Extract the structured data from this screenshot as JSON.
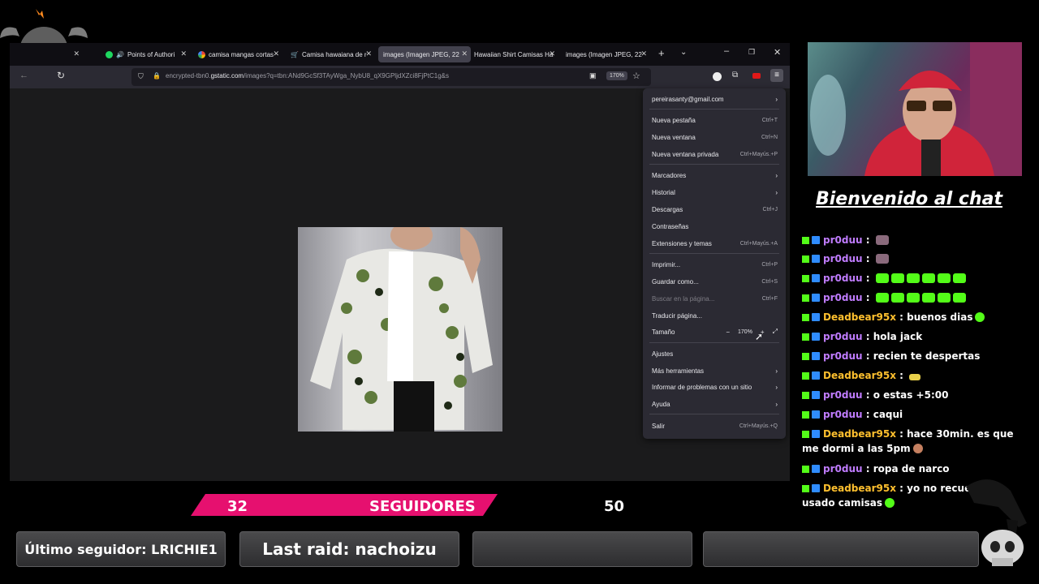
{
  "browser": {
    "tabs": [
      {
        "label": "Points of Authori",
        "icon": "spotify-icon"
      },
      {
        "label": "camisa mangas cortas",
        "icon": "google-icon"
      },
      {
        "label": "Camisa hawaiana de r",
        "icon": "cart-icon"
      },
      {
        "label": "images (Imagen JPEG, 22",
        "icon": "",
        "active": true
      },
      {
        "label": "Hawaiian Shirt Camisas Ha",
        "icon": ""
      },
      {
        "label": "images (Imagen JPEG, 22",
        "icon": ""
      }
    ],
    "url_prefix": "encrypted-tbn0.",
    "url_domain": "gstatic.com",
    "url_rest": "/images?q=tbn:ANd9GcSf3TAyWga_NybU8_qX9GPljdXZci8FjPtC1g&s",
    "zoom_badge": "170%",
    "menu": {
      "account": "pereirasanty@gmail.com",
      "items": [
        {
          "label": "Nueva pestaña",
          "shortcut": "Ctrl+T"
        },
        {
          "label": "Nueva ventana",
          "shortcut": "Ctrl+N"
        },
        {
          "label": "Nueva ventana privada",
          "shortcut": "Ctrl+Mayús.+P"
        },
        {
          "label": "Marcadores",
          "shortcut": ""
        },
        {
          "label": "Historial",
          "shortcut": ""
        },
        {
          "label": "Descargas",
          "shortcut": "Ctrl+J"
        },
        {
          "label": "Contraseñas",
          "shortcut": ""
        },
        {
          "label": "Extensiones y temas",
          "shortcut": "Ctrl+Mayús.+A"
        },
        {
          "label": "Imprimir...",
          "shortcut": "Ctrl+P"
        },
        {
          "label": "Guardar como...",
          "shortcut": "Ctrl+S"
        },
        {
          "label": "Buscar en la página...",
          "shortcut": "Ctrl+F"
        },
        {
          "label": "Traducir página...",
          "shortcut": ""
        },
        {
          "label": "Tamaño",
          "shortcut": ""
        },
        {
          "label": "Ajustes",
          "shortcut": ""
        },
        {
          "label": "Más herramientas",
          "shortcut": ""
        },
        {
          "label": "Informar de problemas con un sitio",
          "shortcut": ""
        },
        {
          "label": "Ayuda",
          "shortcut": ""
        },
        {
          "label": "Salir",
          "shortcut": "Ctrl+Mayús.+Q"
        }
      ],
      "zoom_value": "170%",
      "zoom_minus": "−",
      "zoom_plus": "+"
    }
  },
  "stream": {
    "welcome": "Bienvenido al chat",
    "chat": [
      {
        "user": "pr0duu",
        "msg": ""
      },
      {
        "user": "pr0duu",
        "msg": ""
      },
      {
        "user": "pr0duu",
        "msg": ""
      },
      {
        "user": "pr0duu",
        "msg": ""
      },
      {
        "user": "Deadbear95x",
        "msg": "buenos dias"
      },
      {
        "user": "pr0duu",
        "msg": "hola jack"
      },
      {
        "user": "pr0duu",
        "msg": "recien te despertas"
      },
      {
        "user": "Deadbear95x",
        "msg": ""
      },
      {
        "user": "pr0duu",
        "msg": "o estas +5:00"
      },
      {
        "user": "pr0duu",
        "msg": "caqui"
      },
      {
        "user": "Deadbear95x",
        "msg": "hace 30min. es que me dormi a las 5pm"
      },
      {
        "user": "pr0duu",
        "msg": "ropa de narco"
      },
      {
        "user": "Deadbear95x",
        "msg": "yo no recuerdo h usado camisas"
      }
    ],
    "sep": " : ",
    "followers_current": "32",
    "followers_label": "SEGUIDORES",
    "followers_goal": "50",
    "last_follower": "Último seguidor: LRICHIE1",
    "last_raid": "Last raid: nachoizu"
  },
  "colors": {
    "accent_pink": "#e6106f",
    "kick_green": "#53fc18",
    "user_purple": "#c07cff",
    "user_gold": "#ffc02e"
  }
}
